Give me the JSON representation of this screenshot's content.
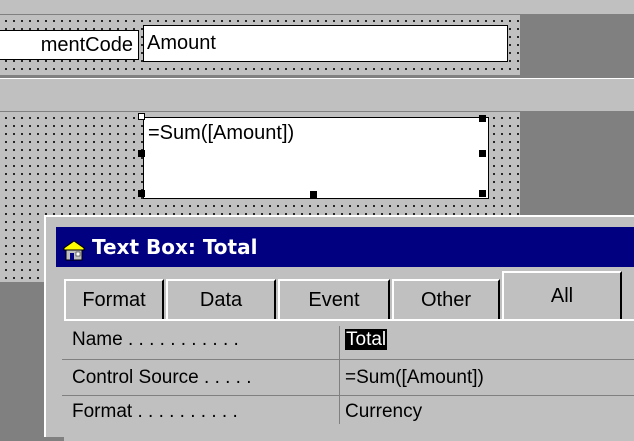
{
  "design": {
    "label_partial": "mentCode",
    "amount_field_text": "Amount",
    "total_field_text": "=Sum([Amount])"
  },
  "palette": {
    "title": "Text Box: Total",
    "tabs": [
      "Format",
      "Data",
      "Event",
      "Other",
      "All"
    ],
    "active_tab": "All",
    "properties": [
      {
        "label": "Name . . . . . . . . . . .",
        "value": "Total"
      },
      {
        "label": "Control Source . . . . .",
        "value": "=Sum([Amount])"
      },
      {
        "label": "Format . . . . . . . . . .",
        "value": "Currency"
      }
    ],
    "colors": {
      "title_bg": "#000080",
      "selected_bg": "#000000"
    }
  }
}
